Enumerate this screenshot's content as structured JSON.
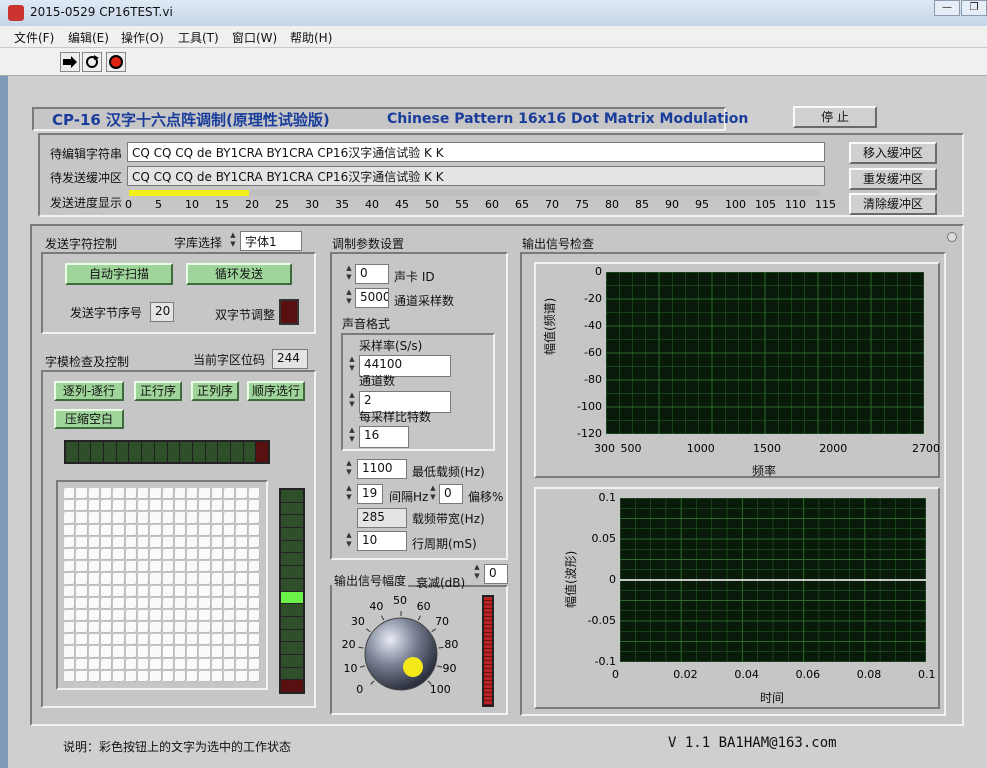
{
  "window": {
    "title": "2015-0529 CP16TEST.vi",
    "min_label": "—",
    "max_label": "❐"
  },
  "menu": [
    "文件(F)",
    "编辑(E)",
    "操作(O)",
    "工具(T)",
    "窗口(W)",
    "帮助(H)"
  ],
  "header": {
    "title_cn": "CP-16  汉字十六点阵调制(原理性试验版)",
    "title_en": "Chinese Pattern 16x16 Dot Matrix Modulation",
    "stop_label": "停 止"
  },
  "edit_row": {
    "label": "待编辑字符串",
    "value": "CQ CQ CQ de BY1CRA BY1CRA CP16汉字通信试验 K K"
  },
  "buffer_row": {
    "label": "待发送缓冲区",
    "value": "CQ CQ CQ de BY1CRA BY1CRA CP16汉字通信试验 K K"
  },
  "progress": {
    "label": "发送进度显示",
    "value": 20,
    "max": 115,
    "ticks": [
      "0",
      "5",
      "10",
      "15",
      "20",
      "25",
      "30",
      "35",
      "40",
      "45",
      "50",
      "55",
      "60",
      "65",
      "70",
      "75",
      "80",
      "85",
      "90",
      "95",
      "100",
      "105",
      "110",
      "115"
    ]
  },
  "buffer_buttons": {
    "move_in": "移入缓冲区",
    "resend": "重发缓冲区",
    "clear": "清除缓冲区"
  },
  "send_ctrl": {
    "title": "发送字符控制",
    "font_label": "字库选择",
    "font_value": "字体1",
    "auto_scan": "自动字扫描",
    "loop_send": "循环发送",
    "byte_index_label": "发送字节序号",
    "byte_index_value": "20",
    "double_byte_label": "双字节调整"
  },
  "matrix_ctrl": {
    "title": "字模检查及控制",
    "code_label": "当前字区位码",
    "code_value": "244",
    "buttons": [
      "逐列-逐行",
      "正行序",
      "正列序",
      "顺序选行",
      "压缩空白"
    ]
  },
  "mod_params": {
    "title": "调制参数设置",
    "card_id_value": "0",
    "card_id_label": "声卡 ID",
    "channel_rate_value": "5000",
    "channel_rate_label": "通道采样数",
    "sound_format_label": "声音格式",
    "sample_rate_label": "采样率(S/s)",
    "sample_rate_value": "44100",
    "channels_label": "通道数",
    "channels_value": "2",
    "bits_label": "每采样比特数",
    "bits_value": "16",
    "min_freq_value": "1100",
    "min_freq_label": "最低载频(Hz)",
    "interval_value": "19",
    "interval_label": "间隔Hz",
    "offset_value": "0",
    "offset_label": "偏移%",
    "bandwidth_value": "285",
    "bandwidth_label": "载频带宽(Hz)",
    "line_period_value": "10",
    "line_period_label": "行周期(mS)"
  },
  "output_amp": {
    "title": "输出信号幅度",
    "atten_label": "衰减(dB)",
    "atten_value": "0",
    "knob_labels": [
      "0",
      "10",
      "20",
      "30",
      "40",
      "50",
      "60",
      "70",
      "80",
      "90",
      "100"
    ]
  },
  "signal_check": {
    "title": "输出信号检查"
  },
  "spectrum": {
    "ylabel": "幅值(频谱)",
    "xlabel": "频率",
    "yticks": [
      "0",
      "-20",
      "-40",
      "-60",
      "-80",
      "-100",
      "-120"
    ],
    "xticks": [
      "300",
      "500",
      "1000",
      "1500",
      "2000",
      "2700"
    ]
  },
  "waveform": {
    "ylabel": "幅值(波形)",
    "xlabel": "时间",
    "yticks": [
      "0.1",
      "0.05",
      "0",
      "-0.05",
      "-0.1"
    ],
    "xticks": [
      "0",
      "0.02",
      "0.04",
      "0.06",
      "0.08",
      "0.1"
    ]
  },
  "footer": {
    "note": "说明：彩色按钮上的文字为选中的工作状态",
    "version": "V 1.1   BA1HAM@163.com"
  },
  "colors": {
    "panel": "#cfcfcf",
    "title_blue": "#1a3d9c",
    "led_green": "#2f4f2a",
    "led_on": "#6df24a",
    "plot_bg": "#0a1a0a",
    "grid": "#2b6b2b"
  }
}
